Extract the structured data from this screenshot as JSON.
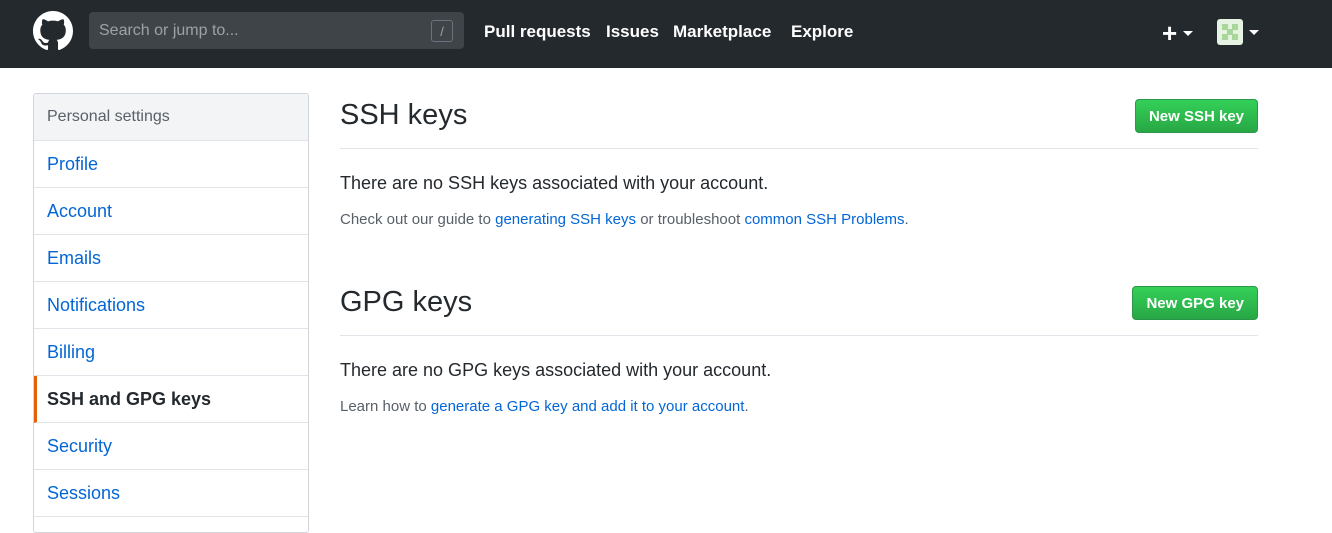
{
  "header": {
    "search_placeholder": "Search or jump to...",
    "search_shortcut": "/",
    "nav": [
      "Pull requests",
      "Issues",
      "Marketplace",
      "Explore"
    ],
    "plus_icon": "+"
  },
  "sidebar": {
    "title": "Personal settings",
    "items": [
      {
        "label": "Profile"
      },
      {
        "label": "Account"
      },
      {
        "label": "Emails"
      },
      {
        "label": "Notifications"
      },
      {
        "label": "Billing"
      },
      {
        "label": "SSH and GPG keys",
        "selected": true
      },
      {
        "label": "Security"
      },
      {
        "label": "Sessions"
      }
    ]
  },
  "ssh": {
    "title": "SSH keys",
    "button": "New SSH key",
    "empty_text": "There are no SSH keys associated with your account.",
    "guide_prefix": "Check out our guide to ",
    "guide_link1": "generating SSH keys",
    "guide_middle": " or troubleshoot ",
    "guide_link2": "common SSH Problems",
    "guide_suffix": "."
  },
  "gpg": {
    "title": "GPG keys",
    "button": "New GPG key",
    "empty_text": "There are no GPG keys associated with your account.",
    "learn_prefix": "Learn how to ",
    "learn_link": "generate a GPG key and add it to your account",
    "learn_suffix": "."
  },
  "colors": {
    "header_bg": "#24292e",
    "link": "#0366d6",
    "button_green": "#28a745",
    "selected_accent": "#e36209"
  }
}
